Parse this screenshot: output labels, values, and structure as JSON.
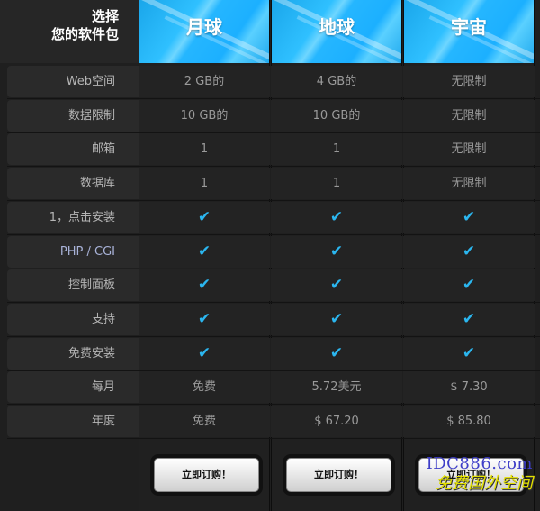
{
  "corner_title_line1": "选择",
  "corner_title_line2": "您的软件包",
  "plans": [
    {
      "name": "月球",
      "button": "立即订购！"
    },
    {
      "name": "地球",
      "button": "立即订购！"
    },
    {
      "name": "宇宙",
      "button": "立即订购！"
    }
  ],
  "rows": [
    {
      "label": "Web空间",
      "values": [
        "2 GB的",
        "4 GB的",
        "无限制"
      ]
    },
    {
      "label": "数据限制",
      "values": [
        "10 GB的",
        "10 GB的",
        "无限制"
      ]
    },
    {
      "label": "邮箱",
      "values": [
        "1",
        "1",
        "无限制"
      ]
    },
    {
      "label": "数据库",
      "values": [
        "1",
        "1",
        "无限制"
      ]
    },
    {
      "label": "1，点击安装",
      "values": [
        "✔",
        "✔",
        "✔"
      ]
    },
    {
      "label": "PHP / CGI",
      "values": [
        "✔",
        "✔",
        "✔"
      ]
    },
    {
      "label": "控制面板",
      "values": [
        "✔",
        "✔",
        "✔"
      ]
    },
    {
      "label": "支持",
      "values": [
        "✔",
        "✔",
        "✔"
      ]
    },
    {
      "label": "免费安装",
      "values": [
        "✔",
        "✔",
        "✔"
      ]
    },
    {
      "label": "每月",
      "values": [
        "免费",
        "5.72美元",
        "$ 7.30"
      ]
    },
    {
      "label": "年度",
      "values": [
        "免费",
        "$ 67.20",
        "$ 85.80"
      ]
    }
  ],
  "watermark_line1": "IDC886.com",
  "watermark_line2": "免费国外空间",
  "colors": {
    "accent": "#1cb0ff",
    "check": "#2bb6ef"
  }
}
